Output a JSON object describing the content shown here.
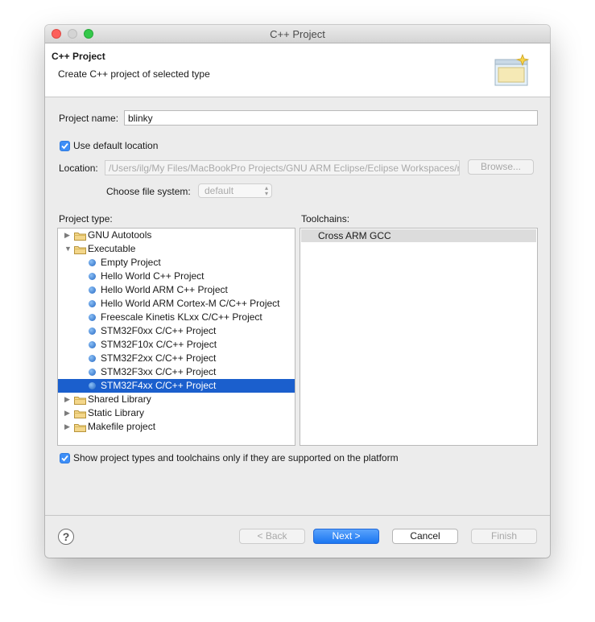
{
  "window": {
    "title": "C++ Project"
  },
  "header": {
    "title": "C++ Project",
    "description": "Create C++ project of selected type"
  },
  "form": {
    "project_name_label": "Project name:",
    "project_name_value": "blinky",
    "use_default_location_label": "Use default location",
    "use_default_location_checked": true,
    "location_label": "Location:",
    "location_value": "/Users/ilg/My Files/MacBookPro Projects/GNU ARM Eclipse/Eclipse Workspaces/r",
    "browse_label": "Browse...",
    "file_system_label": "Choose file system:",
    "file_system_value": "default"
  },
  "project_type": {
    "label": "Project type:",
    "items": [
      {
        "label": "GNU Autotools",
        "kind": "folder",
        "expanded": false
      },
      {
        "label": "Executable",
        "kind": "folder",
        "expanded": true
      },
      {
        "label": "Empty Project",
        "kind": "leaf"
      },
      {
        "label": "Hello World C++ Project",
        "kind": "leaf"
      },
      {
        "label": "Hello World ARM C++ Project",
        "kind": "leaf"
      },
      {
        "label": "Hello World ARM Cortex-M C/C++ Project",
        "kind": "leaf"
      },
      {
        "label": "Freescale Kinetis KLxx C/C++ Project",
        "kind": "leaf"
      },
      {
        "label": "STM32F0xx C/C++ Project",
        "kind": "leaf"
      },
      {
        "label": "STM32F10x C/C++ Project",
        "kind": "leaf"
      },
      {
        "label": "STM32F2xx C/C++ Project",
        "kind": "leaf"
      },
      {
        "label": "STM32F3xx C/C++ Project",
        "kind": "leaf"
      },
      {
        "label": "STM32F4xx C/C++ Project",
        "kind": "leaf",
        "selected": true
      },
      {
        "label": "Shared Library",
        "kind": "folder",
        "expanded": false
      },
      {
        "label": "Static Library",
        "kind": "folder",
        "expanded": false
      },
      {
        "label": "Makefile project",
        "kind": "folder",
        "expanded": false
      }
    ]
  },
  "toolchains": {
    "label": "Toolchains:",
    "items": [
      "Cross ARM GCC"
    ]
  },
  "filter": {
    "label": "Show project types and toolchains only if they are supported on the platform",
    "checked": true
  },
  "buttons": {
    "back": "< Back",
    "next": "Next >",
    "cancel": "Cancel",
    "finish": "Finish",
    "help": "?"
  },
  "colors": {
    "accent": "#1b76f1",
    "selection": "#1b5fcd"
  }
}
